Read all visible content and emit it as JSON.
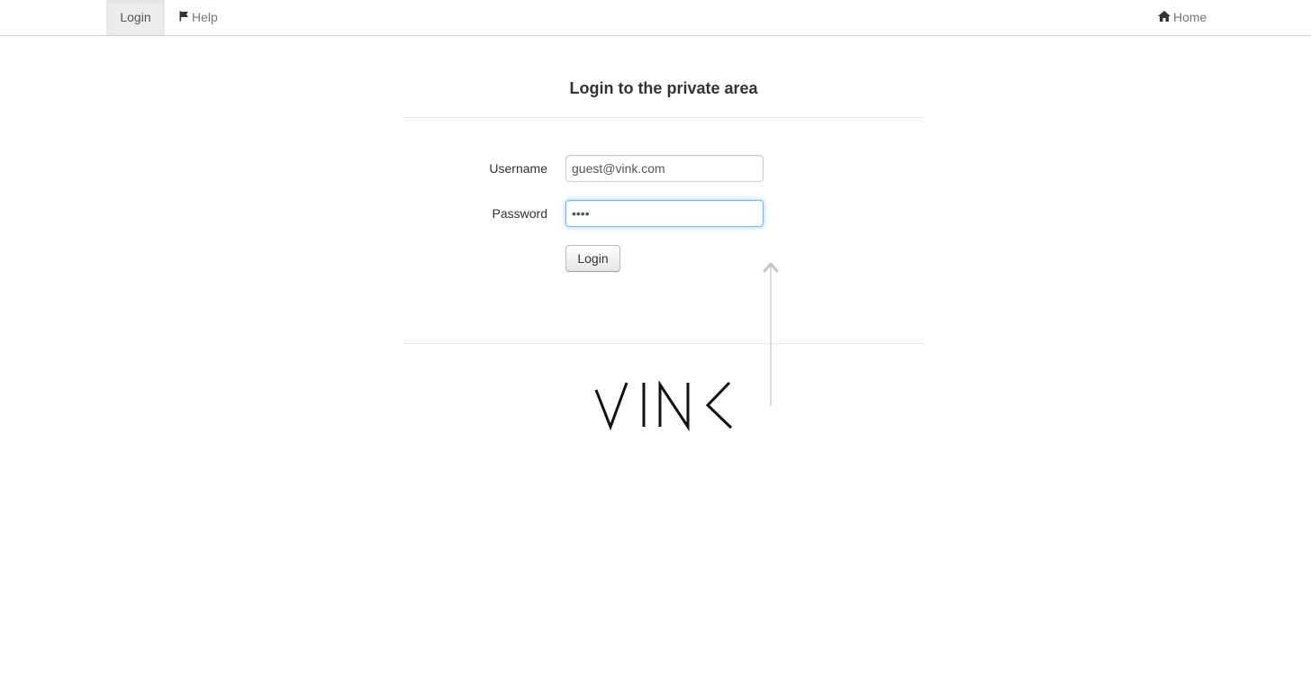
{
  "navbar": {
    "login_label": "Login",
    "help_label": "Help",
    "home_label": "Home",
    "help_icon": "flag-icon",
    "home_icon": "home-icon"
  },
  "form": {
    "title": "Login to the private area",
    "username_label": "Username",
    "username_value": "guest@vink.com",
    "password_label": "Password",
    "password_value": "••••",
    "submit_label": "Login"
  },
  "footer": {
    "logo_text": "VINK"
  },
  "colors": {
    "focus_border": "#52a8ec",
    "nav_active_bg": "#ececec",
    "text": "#333333",
    "nav_text": "#777777"
  }
}
